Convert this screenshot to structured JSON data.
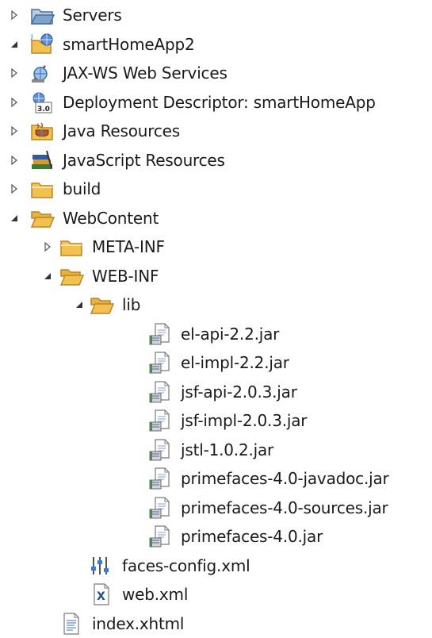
{
  "tree": {
    "items": [
      {
        "label": "Servers",
        "icon": "server-folder-icon",
        "state": "collapsed"
      },
      {
        "label": "smartHomeApp2",
        "icon": "web-project-icon",
        "state": "expanded"
      },
      {
        "label": "JAX-WS Web Services",
        "icon": "web-services-icon",
        "state": "collapsed"
      },
      {
        "label": "Deployment Descriptor: smartHomeApp",
        "icon": "deployment-descriptor-icon",
        "state": "collapsed"
      },
      {
        "label": "Java Resources",
        "icon": "java-resources-icon",
        "state": "collapsed"
      },
      {
        "label": "JavaScript Resources",
        "icon": "javascript-resources-icon",
        "state": "collapsed"
      },
      {
        "label": "build",
        "icon": "folder-icon",
        "state": "collapsed"
      },
      {
        "label": "WebContent",
        "icon": "folder-open-icon",
        "state": "expanded"
      },
      {
        "label": "META-INF",
        "icon": "folder-icon",
        "state": "collapsed"
      },
      {
        "label": "WEB-INF",
        "icon": "folder-open-icon",
        "state": "expanded"
      },
      {
        "label": "lib",
        "icon": "folder-open-icon",
        "state": "expanded"
      },
      {
        "label": "el-api-2.2.jar",
        "icon": "jar-file-icon",
        "state": "leaf"
      },
      {
        "label": "el-impl-2.2.jar",
        "icon": "jar-file-icon",
        "state": "leaf"
      },
      {
        "label": "jsf-api-2.0.3.jar",
        "icon": "jar-file-icon",
        "state": "leaf"
      },
      {
        "label": "jsf-impl-2.0.3.jar",
        "icon": "jar-file-icon",
        "state": "leaf"
      },
      {
        "label": "jstl-1.0.2.jar",
        "icon": "jar-file-icon",
        "state": "leaf"
      },
      {
        "label": "primefaces-4.0-javadoc.jar",
        "icon": "jar-file-icon",
        "state": "leaf"
      },
      {
        "label": "primefaces-4.0-sources.jar",
        "icon": "jar-file-icon",
        "state": "leaf"
      },
      {
        "label": "primefaces-4.0.jar",
        "icon": "jar-file-icon",
        "state": "leaf"
      },
      {
        "label": "faces-config.xml",
        "icon": "faces-config-icon",
        "state": "leaf"
      },
      {
        "label": "web.xml",
        "icon": "xml-file-icon",
        "state": "leaf"
      },
      {
        "label": "index.xhtml",
        "icon": "xhtml-file-icon",
        "state": "leaf"
      }
    ]
  },
  "colors": {
    "folder": "#f2c14e",
    "folder_stroke": "#b8862b",
    "twisty": "#555555",
    "twisty_open": "#333333"
  }
}
